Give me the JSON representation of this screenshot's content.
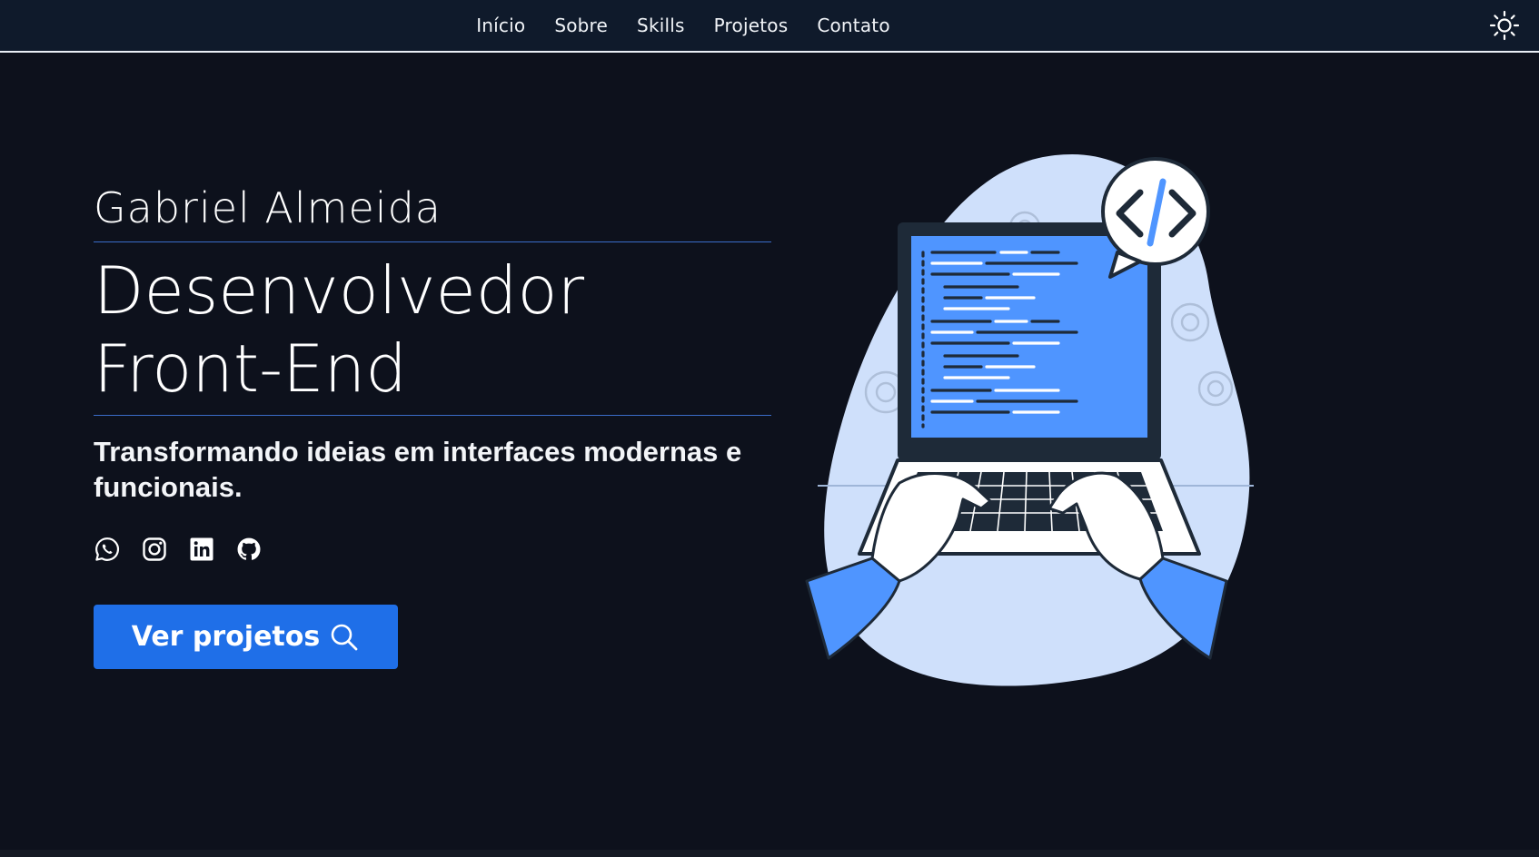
{
  "nav": {
    "links": [
      {
        "label": "Início"
      },
      {
        "label": "Sobre"
      },
      {
        "label": "Skills"
      },
      {
        "label": "Projetos"
      },
      {
        "label": "Contato"
      }
    ],
    "theme_toggle_icon": "sun-icon"
  },
  "hero": {
    "name": "Gabriel Almeida",
    "title_line1": "Desenvolvedor",
    "title_line2": "Front-End",
    "subtitle": "Transformando ideias em interfaces modernas e funcionais.",
    "social_icons": [
      "whatsapp-icon",
      "instagram-icon",
      "linkedin-icon",
      "github-icon"
    ],
    "cta_label": "Ver projetos",
    "cta_icon": "search-icon"
  },
  "colors": {
    "background": "#0d111c",
    "navbar": "#0f1a2b",
    "accent": "#1f6fe8",
    "illustration_blue": "#4f95ff",
    "illustration_light": "#cfe0fb"
  }
}
